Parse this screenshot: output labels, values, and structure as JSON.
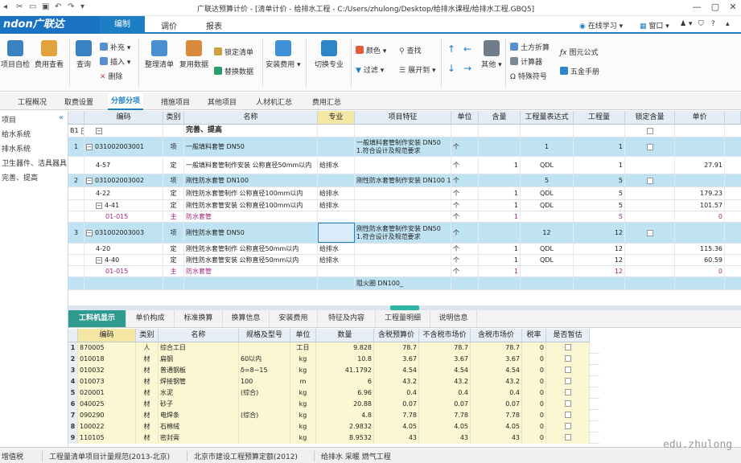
{
  "app": {
    "title": "广联达预算计价 - [清单计价 - 给排水工程 - C:/Users/zhulong/Desktop/给排水课程/给排水工程.GBQ5]",
    "logo": "ndon广联达"
  },
  "menu": {
    "items": [
      "编制",
      "调价",
      "报表"
    ],
    "active": "编制",
    "right": [
      "在线学习",
      "窗口"
    ]
  },
  "ribbon": {
    "large": [
      {
        "label": "项目自检",
        "color": "#3b82c4"
      },
      {
        "label": "费用查看",
        "color": "#e0a43a"
      },
      {
        "label": "查询",
        "color": "#3b82c4"
      },
      {
        "label": "整理清单",
        "color": "#4a8fd0"
      },
      {
        "label": "复用数据",
        "color": "#d88a3b"
      },
      {
        "label": "安装费用",
        "color": "#3d8fd6"
      },
      {
        "label": "切换专业",
        "color": "#2c86c7"
      },
      {
        "label": "其他",
        "color": "#6f7c8a"
      }
    ],
    "small": [
      "补充",
      "插入",
      "删除",
      "锁定清单",
      "替换数据",
      "颜色",
      "查找",
      "过滤",
      "展开到",
      "土方折算",
      "计算器",
      "特殊符号",
      "图元公式",
      "五金手册"
    ]
  },
  "tabs": {
    "items": [
      "工程概况",
      "取费设置",
      "分部分项",
      "措施项目",
      "其他项目",
      "人材机汇总",
      "费用汇总"
    ],
    "active": "分部分项"
  },
  "sidebar": {
    "items": [
      "项目",
      "给水系统",
      "排水系统",
      "卫生器件、洁具器具",
      "完善、提高"
    ]
  },
  "grid": {
    "headers": [
      "编码",
      "类别",
      "名称",
      "专业",
      "项目特征",
      "单位",
      "含量",
      "工程量表达式",
      "工程量",
      "锁定含量",
      "单价"
    ],
    "rows": [
      {
        "idx": "B1",
        "code": "",
        "type": "",
        "name": "完善、提高",
        "spec": "",
        "feature": "",
        "unit": "",
        "qty_ratio": "",
        "expr": "",
        "qty": "",
        "price": "",
        "kind": "b1"
      },
      {
        "idx": "1",
        "code": "031002003001",
        "type": "项",
        "name": "一般填料套管 DN50",
        "spec": "",
        "feature": "一般填料套管制作安装 DN50 1.符合设计及规范要求",
        "unit": "个",
        "qty_ratio": "",
        "expr": "1",
        "qty": "1",
        "price": "",
        "kind": "sec"
      },
      {
        "idx": "",
        "code": "4-57",
        "type": "定",
        "name": "一般填料套管制作安装 公称直径50mm以内",
        "spec": "给排水",
        "feature": "",
        "unit": "个",
        "qty_ratio": "1",
        "expr": "QDL",
        "qty": "1",
        "price": "27.91",
        "kind": "sub"
      },
      {
        "idx": "2",
        "code": "031002003002",
        "type": "项",
        "name": "刚性防水套管 DN100",
        "spec": "",
        "feature": "刚性防水套管制作安装 DN100 1.符合设计及规范要求",
        "unit": "个",
        "qty_ratio": "",
        "expr": "5",
        "qty": "5",
        "price": "",
        "kind": "sec"
      },
      {
        "idx": "",
        "code": "4-22",
        "type": "定",
        "name": "刚性防水套管制作 公称直径100mm以内",
        "spec": "给排水",
        "feature": "",
        "unit": "个",
        "qty_ratio": "1",
        "expr": "QDL",
        "qty": "5",
        "price": "179.23",
        "kind": "sub"
      },
      {
        "idx": "",
        "code": "4-41",
        "type": "定",
        "name": "刚性防水套管安装 公称直径100mm以内",
        "spec": "给排水",
        "feature": "",
        "unit": "个",
        "qty_ratio": "1",
        "expr": "QDL",
        "qty": "5",
        "price": "101.57",
        "kind": "sub"
      },
      {
        "idx": "",
        "code": "01-015",
        "type": "主",
        "name": "防水套管",
        "spec": "",
        "feature": "",
        "unit": "个",
        "qty_ratio": "1",
        "expr": "",
        "qty": "5",
        "price": "0",
        "kind": "main"
      },
      {
        "idx": "3",
        "code": "031002003003",
        "type": "项",
        "name": "刚性防水套管 DN50",
        "spec": "",
        "feature": "刚性防水套管制作安装 DN50 1.符合设计及规范要求",
        "unit": "个",
        "qty_ratio": "",
        "expr": "12",
        "qty": "12",
        "price": "",
        "kind": "sec"
      },
      {
        "idx": "",
        "code": "4-20",
        "type": "定",
        "name": "刚性防水套管制作 公称直径50mm以内",
        "spec": "给排水",
        "feature": "",
        "unit": "个",
        "qty_ratio": "1",
        "expr": "QDL",
        "qty": "12",
        "price": "115.36",
        "kind": "sub"
      },
      {
        "idx": "",
        "code": "4-40",
        "type": "定",
        "name": "刚性防水套管安装 公称直径50mm以内",
        "spec": "给排水",
        "feature": "",
        "unit": "个",
        "qty_ratio": "1",
        "expr": "QDL",
        "qty": "12",
        "price": "60.59",
        "kind": "sub"
      },
      {
        "idx": "",
        "code": "01-015",
        "type": "主",
        "name": "防水套管",
        "spec": "",
        "feature": "",
        "unit": "个",
        "qty_ratio": "1",
        "expr": "",
        "qty": "12",
        "price": "0",
        "kind": "main"
      },
      {
        "idx": "",
        "code": "",
        "type": "",
        "name": "",
        "spec": "",
        "feature": "阻火圈 DN100_",
        "unit": "",
        "qty_ratio": "",
        "expr": "",
        "qty": "",
        "price": "",
        "kind": "sec"
      }
    ]
  },
  "tabs2": {
    "items": [
      "工料机显示",
      "单价构成",
      "标准换算",
      "换算信息",
      "安装费用",
      "特征及内容",
      "工程量明细",
      "说明信息"
    ],
    "active": "工料机显示"
  },
  "grid2": {
    "headers": [
      "编码",
      "类别",
      "名称",
      "规格及型号",
      "单位",
      "数量",
      "含税预算价",
      "不含税市场价",
      "含税市场价",
      "税率",
      "是否暂估"
    ],
    "rows": [
      {
        "n": "1",
        "code": "870005",
        "type": "人",
        "name": "综合工日",
        "model": "",
        "unit": "工日",
        "qty": "9.828",
        "p1": "78.7",
        "p2": "78.7",
        "p3": "78.7",
        "tax": "0"
      },
      {
        "n": "2",
        "code": "010018",
        "type": "材",
        "name": "扁钢",
        "model": "60以内",
        "unit": "kg",
        "qty": "10.8",
        "p1": "3.67",
        "p2": "3.67",
        "p3": "3.67",
        "tax": "0"
      },
      {
        "n": "3",
        "code": "010032",
        "type": "材",
        "name": "普通钢板",
        "model": "δ=8~15",
        "unit": "kg",
        "qty": "41.1792",
        "p1": "4.54",
        "p2": "4.54",
        "p3": "4.54",
        "tax": "0"
      },
      {
        "n": "4",
        "code": "010073",
        "type": "材",
        "name": "焊接钢管",
        "model": "100",
        "unit": "m",
        "qty": "6",
        "p1": "43.2",
        "p2": "43.2",
        "p3": "43.2",
        "tax": "0"
      },
      {
        "n": "5",
        "code": "020001",
        "type": "材",
        "name": "水泥",
        "model": "(综合)",
        "unit": "kg",
        "qty": "6.96",
        "p1": "0.4",
        "p2": "0.4",
        "p3": "0.4",
        "tax": "0"
      },
      {
        "n": "6",
        "code": "040025",
        "type": "材",
        "name": "砂子",
        "model": "",
        "unit": "kg",
        "qty": "20.88",
        "p1": "0.07",
        "p2": "0.07",
        "p3": "0.07",
        "tax": "0"
      },
      {
        "n": "7",
        "code": "090290",
        "type": "材",
        "name": "电焊条",
        "model": "(综合)",
        "unit": "kg",
        "qty": "4.8",
        "p1": "7.78",
        "p2": "7.78",
        "p3": "7.78",
        "tax": "0"
      },
      {
        "n": "8",
        "code": "100022",
        "type": "材",
        "name": "石棉绒",
        "model": "",
        "unit": "kg",
        "qty": "2.9832",
        "p1": "4.05",
        "p2": "4.05",
        "p3": "4.05",
        "tax": "0"
      },
      {
        "n": "9",
        "code": "110105",
        "type": "材",
        "name": "密封膏",
        "model": "",
        "unit": "kg",
        "qty": "8.9532",
        "p1": "43",
        "p2": "43",
        "p3": "43",
        "tax": "0"
      }
    ]
  },
  "status": {
    "items": [
      "增值税",
      "工程量清单项目计量规范(2013-北京)",
      "北京市建设工程预算定额(2012)",
      "给排水 采暖 燃气工程"
    ]
  },
  "watermark": "edu.zhulong"
}
